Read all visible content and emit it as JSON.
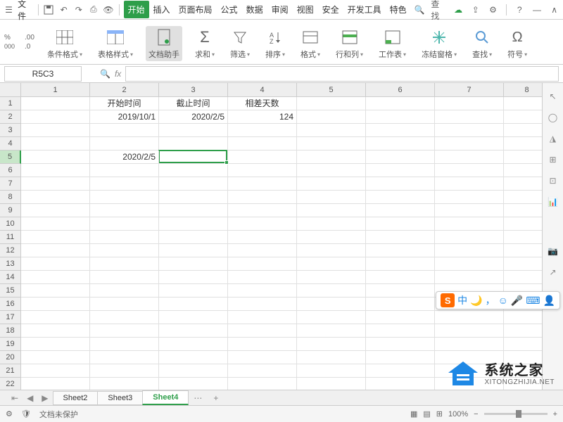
{
  "menu": {
    "file": "文件",
    "search": "查找"
  },
  "tabs": [
    "开始",
    "插入",
    "页面布局",
    "公式",
    "数据",
    "审阅",
    "视图",
    "安全",
    "开发工具",
    "特色"
  ],
  "activeTab": 0,
  "ribbon": {
    "percentFmt": "%",
    "decimals": [
      ".00",
      ".0"
    ],
    "condFormat": "条件格式",
    "tableStyle": "表格样式",
    "docHelper": "文档助手",
    "sum": "求和",
    "filter": "筛选",
    "sort": "排序",
    "format": "格式",
    "rowcol": "行和列",
    "worksheet": "工作表",
    "freeze": "冻结窗格",
    "find": "查找",
    "symbol": "符号"
  },
  "nameBox": "R5C3",
  "columns": [
    1,
    2,
    3,
    4,
    5,
    6,
    7,
    8
  ],
  "rows": [
    1,
    2,
    3,
    4,
    5,
    6,
    7,
    8,
    9,
    10,
    11,
    12,
    13,
    14,
    15,
    16,
    17,
    18,
    19,
    20,
    21,
    22
  ],
  "cells": {
    "r1c2": "开始时间",
    "r1c3": "截止时间",
    "r1c4": "相差天数",
    "r2c2": "2019/10/1",
    "r2c3": "2020/2/5",
    "r2c4": "124",
    "r5c2": "2020/2/5"
  },
  "selectedRow": 5,
  "sheets": [
    "Sheet2",
    "Sheet3",
    "Sheet4"
  ],
  "activeSheet": 2,
  "status": {
    "protect": "文档未保护",
    "zoom": "100%"
  },
  "ime": {
    "lang": "中"
  },
  "watermark": {
    "cn": "系统之家",
    "en": "XITONGZHIJIA.NET"
  }
}
